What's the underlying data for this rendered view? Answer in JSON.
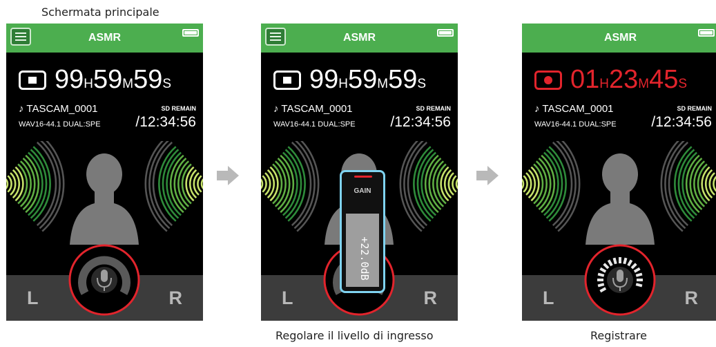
{
  "captions": {
    "screen1": "Schermata principale",
    "screen2": "Regolare il livello di ingresso",
    "screen3": "Registrare"
  },
  "app": {
    "title": "ASMR",
    "file_name": "♪ TASCAM_0001",
    "format": "WAV16-44.1 DUAL:SPE",
    "sd_label": "SD REMAIN",
    "sd_time": "/12:34:56",
    "channel_left": "L",
    "channel_right": "R"
  },
  "screens": [
    {
      "state": "stopped",
      "hours": "99",
      "minutes": "59",
      "seconds": "59",
      "unit_h": "H",
      "unit_m": "M",
      "unit_s": "S"
    },
    {
      "state": "stopped",
      "hours": "99",
      "minutes": "59",
      "seconds": "59",
      "unit_h": "H",
      "unit_m": "M",
      "unit_s": "S"
    },
    {
      "state": "recording",
      "hours": "01",
      "minutes": "23",
      "seconds": "45",
      "unit_h": "H",
      "unit_m": "M",
      "unit_s": "S"
    }
  ],
  "gain": {
    "label": "GAIN",
    "value": "+22.0dB"
  },
  "colors": {
    "topbar": "#4cae4f",
    "record_red": "#e2242c",
    "gain_border": "#7fd3f0",
    "wave_light": "#c6e26a",
    "wave_dark": "#2e8b3a"
  },
  "icons": [
    "menu-icon",
    "battery-icon",
    "stop-icon",
    "record-icon",
    "microphone-icon",
    "arrow-right-icon",
    "head-silhouette-icon"
  ]
}
